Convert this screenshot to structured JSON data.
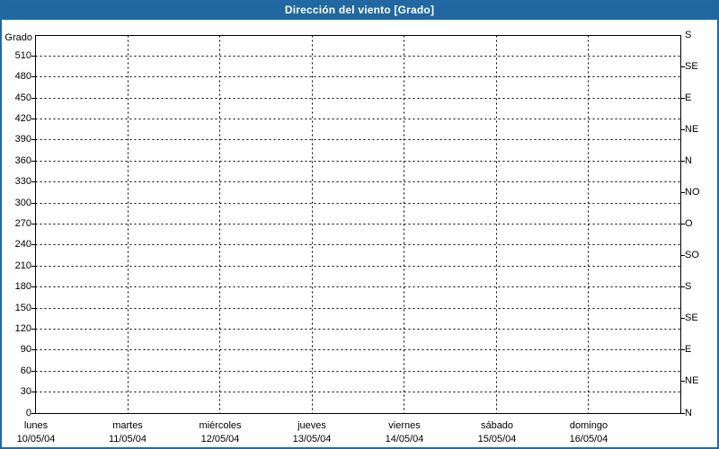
{
  "window": {
    "title": "Dirección del viento [Grado]"
  },
  "colors": {
    "titlebar_background": "#20689f",
    "titlebar_text": "#ffffff",
    "window_border": "#2368a4",
    "plot_background": "#ffffff",
    "grid_and_axis": "#000000"
  },
  "chart_data": {
    "type": "line",
    "title": "Dirección del viento [Grado]",
    "series": [],
    "left_axis": {
      "label": "Grado",
      "range": [
        0,
        540
      ],
      "tick_step": 30,
      "ticks": [
        "510",
        "480",
        "450",
        "420",
        "390",
        "360",
        "330",
        "300",
        "270",
        "240",
        "210",
        "180",
        "150",
        "120",
        "90",
        "60",
        "30",
        "0"
      ]
    },
    "right_axis": {
      "tick_step_degrees": 45,
      "ticks_top_to_bottom": [
        "S",
        "SE",
        "E",
        "NE",
        "N",
        "NO",
        "O",
        "SO",
        "S",
        "SE",
        "E",
        "NE",
        "N"
      ]
    },
    "x_axis": {
      "days": [
        "lunes",
        "martes",
        "miércoles",
        "jueves",
        "viernes",
        "sábado",
        "domingo"
      ],
      "dates": [
        "10/05/04",
        "11/05/04",
        "12/05/04",
        "13/05/04",
        "14/05/04",
        "15/05/04",
        "16/05/04"
      ]
    },
    "grid": "dashed",
    "legend_position": "none"
  }
}
